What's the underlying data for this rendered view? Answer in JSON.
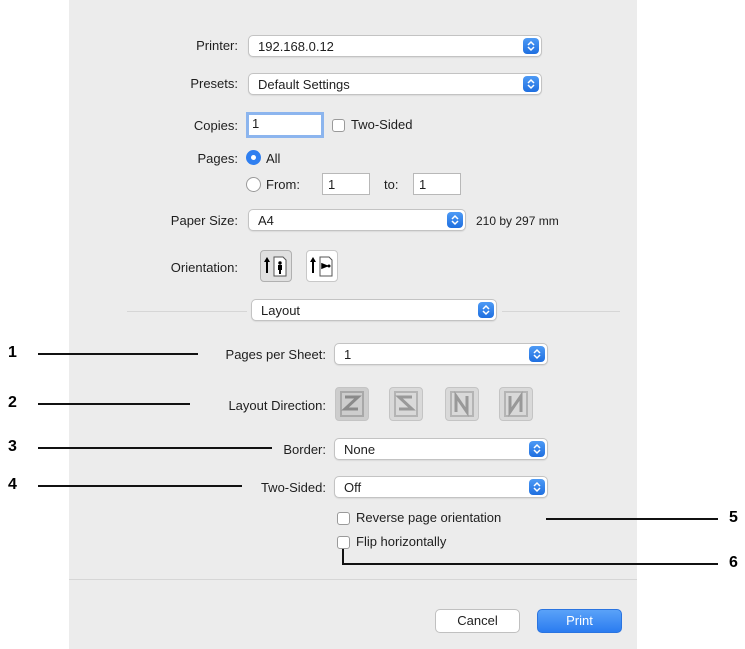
{
  "printer": {
    "label": "Printer:",
    "value": "192.168.0.12"
  },
  "presets": {
    "label": "Presets:",
    "value": "Default Settings"
  },
  "copies": {
    "label": "Copies:",
    "value": "1",
    "two_sided_label": "Two-Sided"
  },
  "pages": {
    "label": "Pages:",
    "all_label": "All",
    "from_label": "From:",
    "from_value": "1",
    "to_label": "to:",
    "to_value": "1"
  },
  "paper_size": {
    "label": "Paper Size:",
    "value": "A4",
    "dimensions": "210 by 297 mm"
  },
  "orientation": {
    "label": "Orientation:",
    "selected": "portrait"
  },
  "section": {
    "value": "Layout"
  },
  "layout": {
    "pages_per_sheet": {
      "label": "Pages per Sheet:",
      "value": "1"
    },
    "layout_direction": {
      "label": "Layout Direction:"
    },
    "border": {
      "label": "Border:",
      "value": "None"
    },
    "two_sided": {
      "label": "Two-Sided:",
      "value": "Off"
    },
    "reverse_label": "Reverse page orientation",
    "flip_label": "Flip horizontally"
  },
  "buttons": {
    "cancel": "Cancel",
    "print": "Print"
  },
  "callouts": [
    "1",
    "2",
    "3",
    "4",
    "5",
    "6"
  ],
  "colors": {
    "accent": "#2f7ff0",
    "dialog_bg": "#ececec"
  }
}
